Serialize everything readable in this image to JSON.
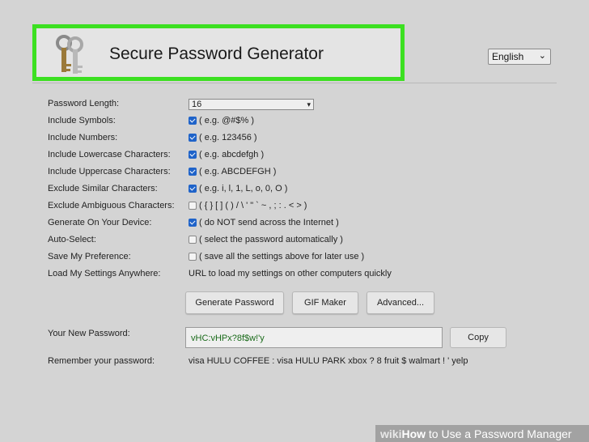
{
  "header": {
    "title": "Secure Password Generator",
    "language": "English"
  },
  "settings": [
    {
      "label": "Password Length:",
      "type": "select",
      "value": "16"
    },
    {
      "label": "Include Symbols:",
      "type": "checkbox",
      "checked": true,
      "text": "( e.g. @#$% )"
    },
    {
      "label": "Include Numbers:",
      "type": "checkbox",
      "checked": true,
      "text": "( e.g. 123456 )"
    },
    {
      "label": "Include Lowercase Characters:",
      "type": "checkbox",
      "checked": true,
      "text": "( e.g. abcdefgh )"
    },
    {
      "label": "Include Uppercase Characters:",
      "type": "checkbox",
      "checked": true,
      "text": "( e.g. ABCDEFGH )"
    },
    {
      "label": "Exclude Similar Characters:",
      "type": "checkbox",
      "checked": true,
      "text": "( e.g. i, l, 1, L, o, 0, O )"
    },
    {
      "label": "Exclude Ambiguous Characters:",
      "type": "checkbox",
      "checked": false,
      "text": "( { } [ ] ( ) / \\ ' \" ` ~ , ; : . < > )"
    },
    {
      "label": "Generate On Your Device:",
      "type": "checkbox",
      "checked": true,
      "text": "( do NOT send across the Internet )"
    },
    {
      "label": "Auto-Select:",
      "type": "checkbox",
      "checked": false,
      "text": "( select the password automatically )"
    },
    {
      "label": "Save My Preference:",
      "type": "checkbox",
      "checked": false,
      "text": "( save all the settings above for later use )"
    },
    {
      "label": "Load My Settings Anywhere:",
      "type": "text",
      "text": "URL to load my settings on other computers quickly"
    }
  ],
  "buttons": {
    "generate": "Generate Password",
    "gif": "GIF Maker",
    "advanced": "Advanced..."
  },
  "result": {
    "label": "Your New Password:",
    "password": "vHC:vHPx?8f$w!'y",
    "copy": "Copy",
    "remember_label": "Remember your password:",
    "remember_text": "visa HULU COFFEE : visa HULU PARK xbox ? 8 fruit $ walmart ! ' yelp"
  },
  "watermark": {
    "brand": "wiki",
    "how": "How",
    "text": "to Use a Password Manager"
  },
  "colors": {
    "highlight": "#3ce021",
    "checkbox": "#1f63c9",
    "password_text": "#1a6b1a"
  }
}
